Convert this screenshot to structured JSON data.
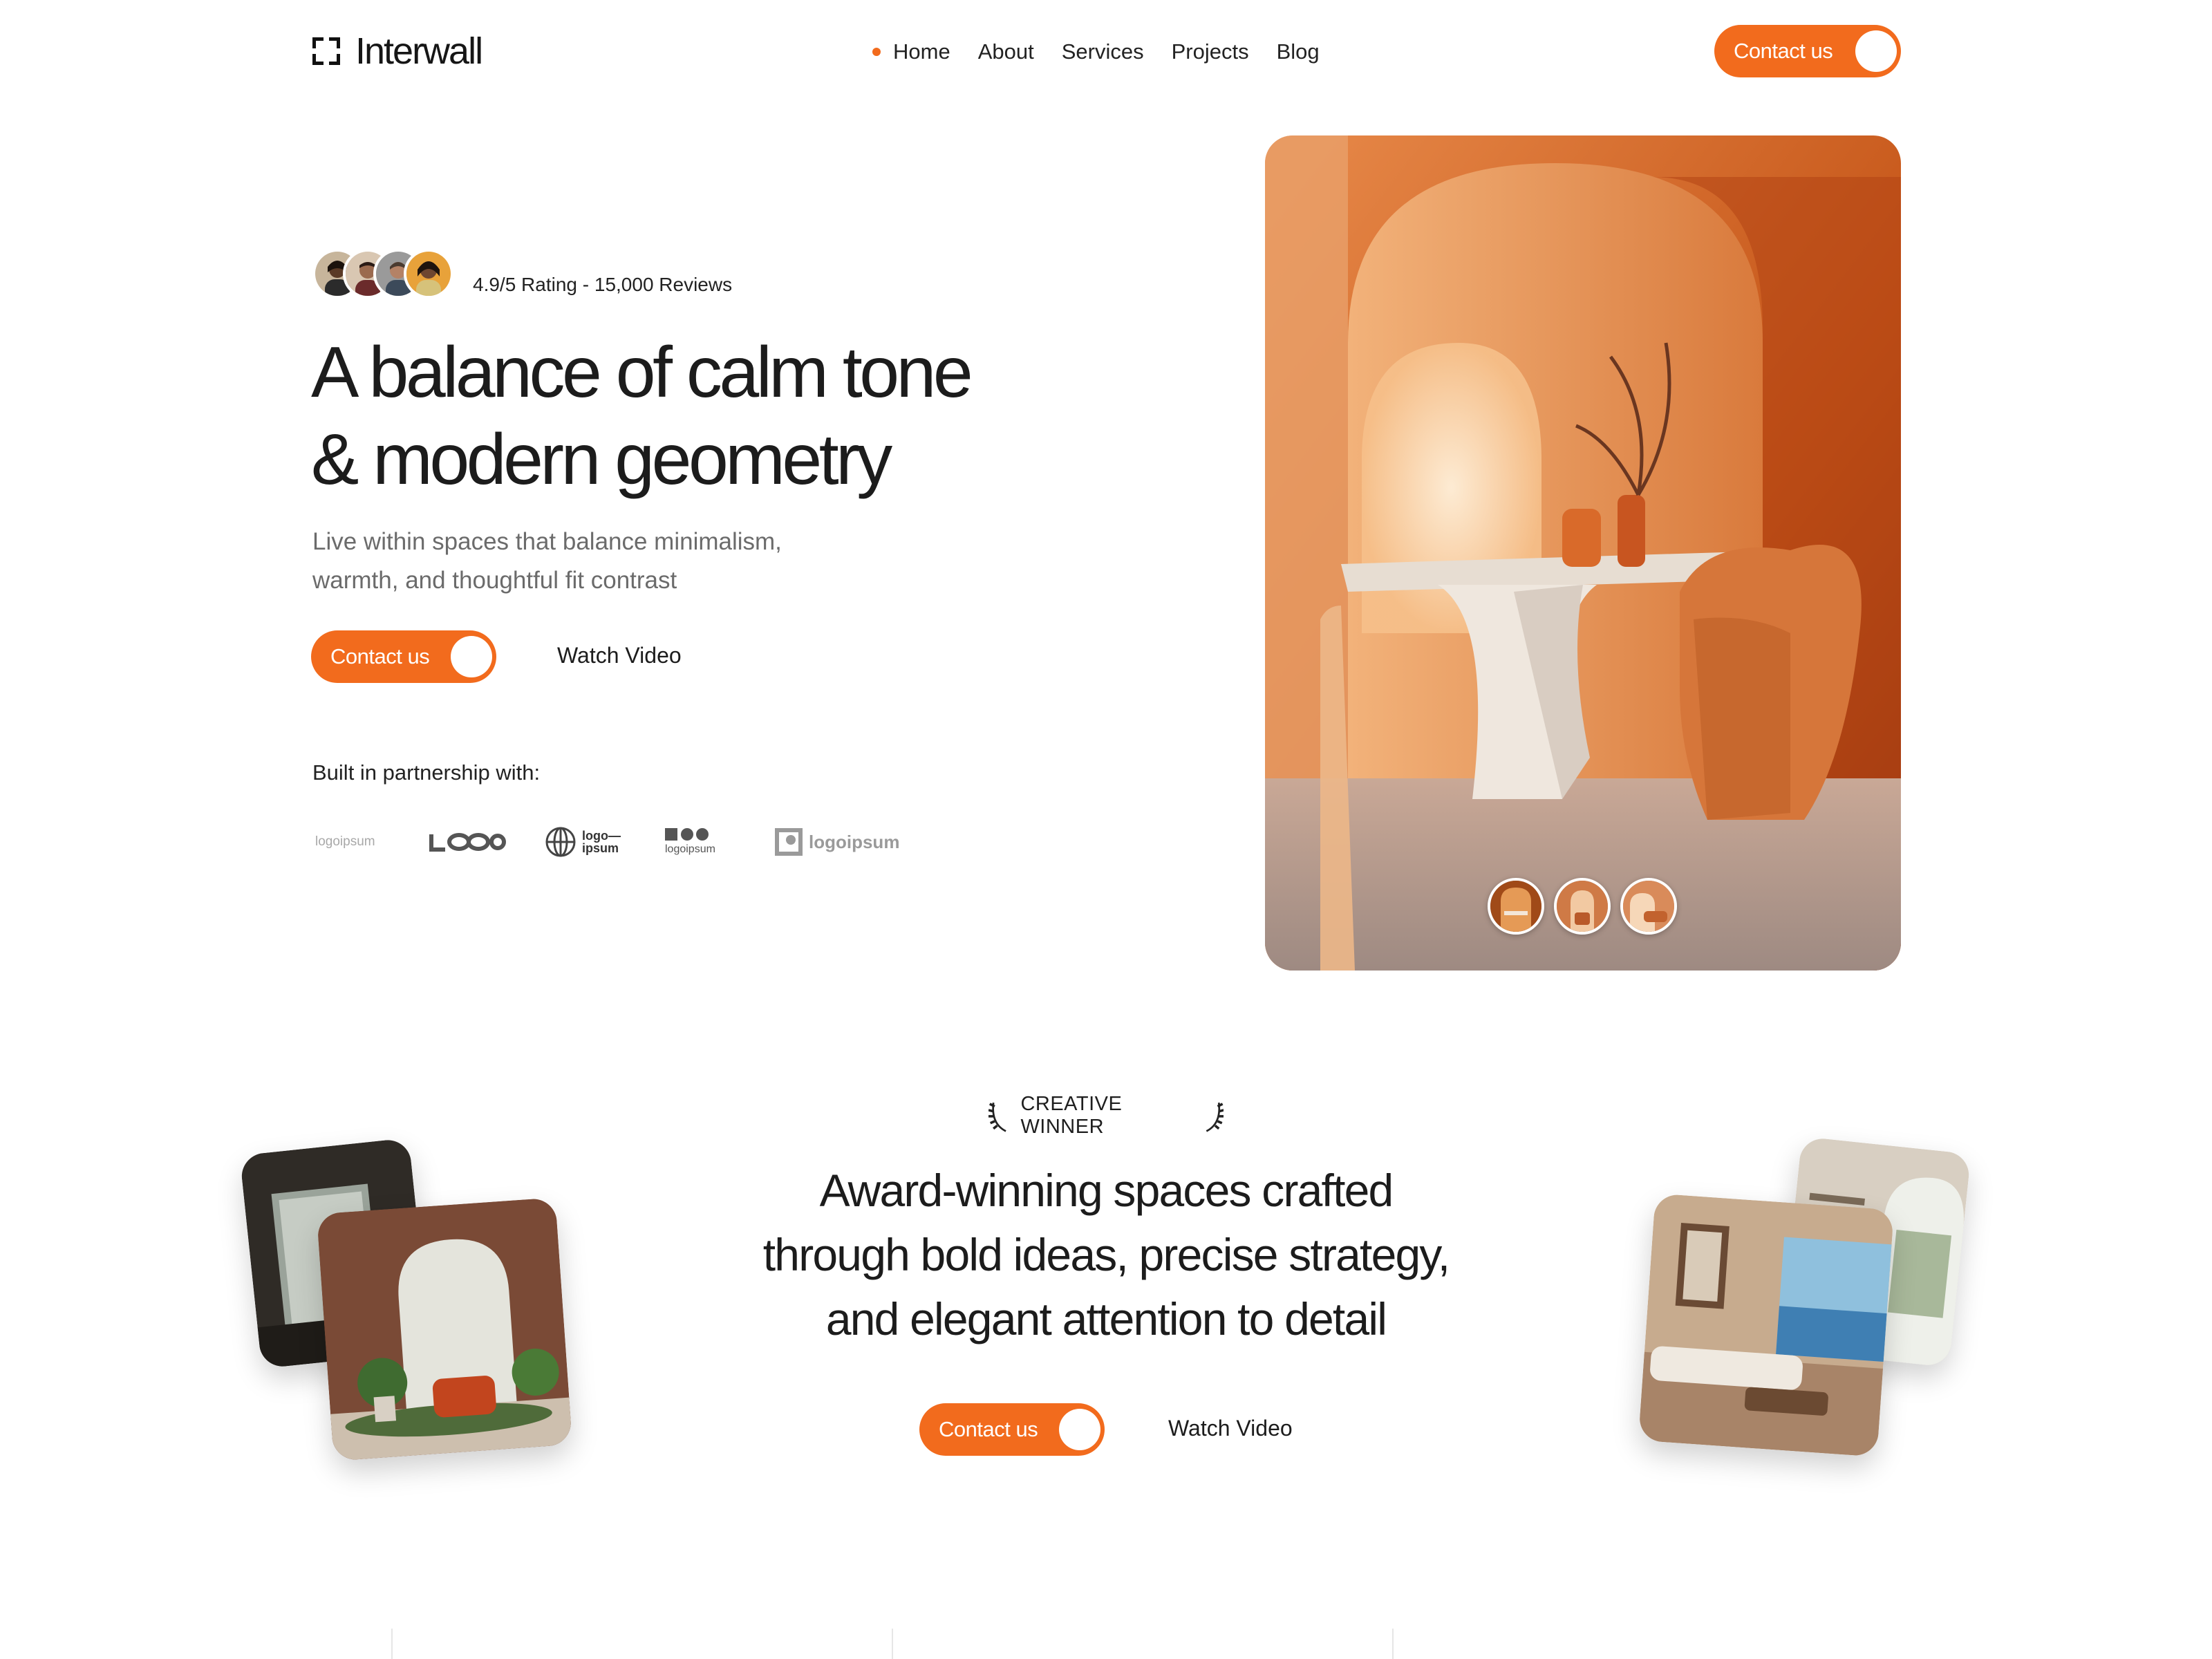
{
  "brand": {
    "name": "Interwall",
    "icon": "bracket-frame-icon"
  },
  "nav": {
    "items": [
      {
        "label": "Home",
        "active": true
      },
      {
        "label": "About",
        "active": false
      },
      {
        "label": "Services",
        "active": false
      },
      {
        "label": "Projects",
        "active": false
      },
      {
        "label": "Blog",
        "active": false
      }
    ],
    "cta_label": "Contact us"
  },
  "hero": {
    "rating_text": "4.9/5 Rating - 15,000 Reviews",
    "title_lines": [
      "A balance of calm tone",
      "& modern geometry"
    ],
    "subtitle_lines": [
      "Live within spaces that balance minimalism,",
      "warmth, and thoughtful fit contrast"
    ],
    "cta_label": "Contact us",
    "watch_label": "Watch Video",
    "partners_label": "Built in partnership with:",
    "partner_logos": [
      "logoipsum",
      "LOGO",
      "logo—ipsum",
      "logoipsum",
      "logoipsum"
    ]
  },
  "award": {
    "badge": "CREATIVE WINNER",
    "title_lines": [
      "Award-winning spaces crafted",
      "through bold ideas, precise strategy,",
      "and elegant attention to detail"
    ],
    "cta_label": "Contact us",
    "watch_label": "Watch Video"
  },
  "colors": {
    "accent": "#f26b1d",
    "text": "#1c1c1c",
    "muted": "#6b6b6b",
    "background": "#ffffff"
  }
}
